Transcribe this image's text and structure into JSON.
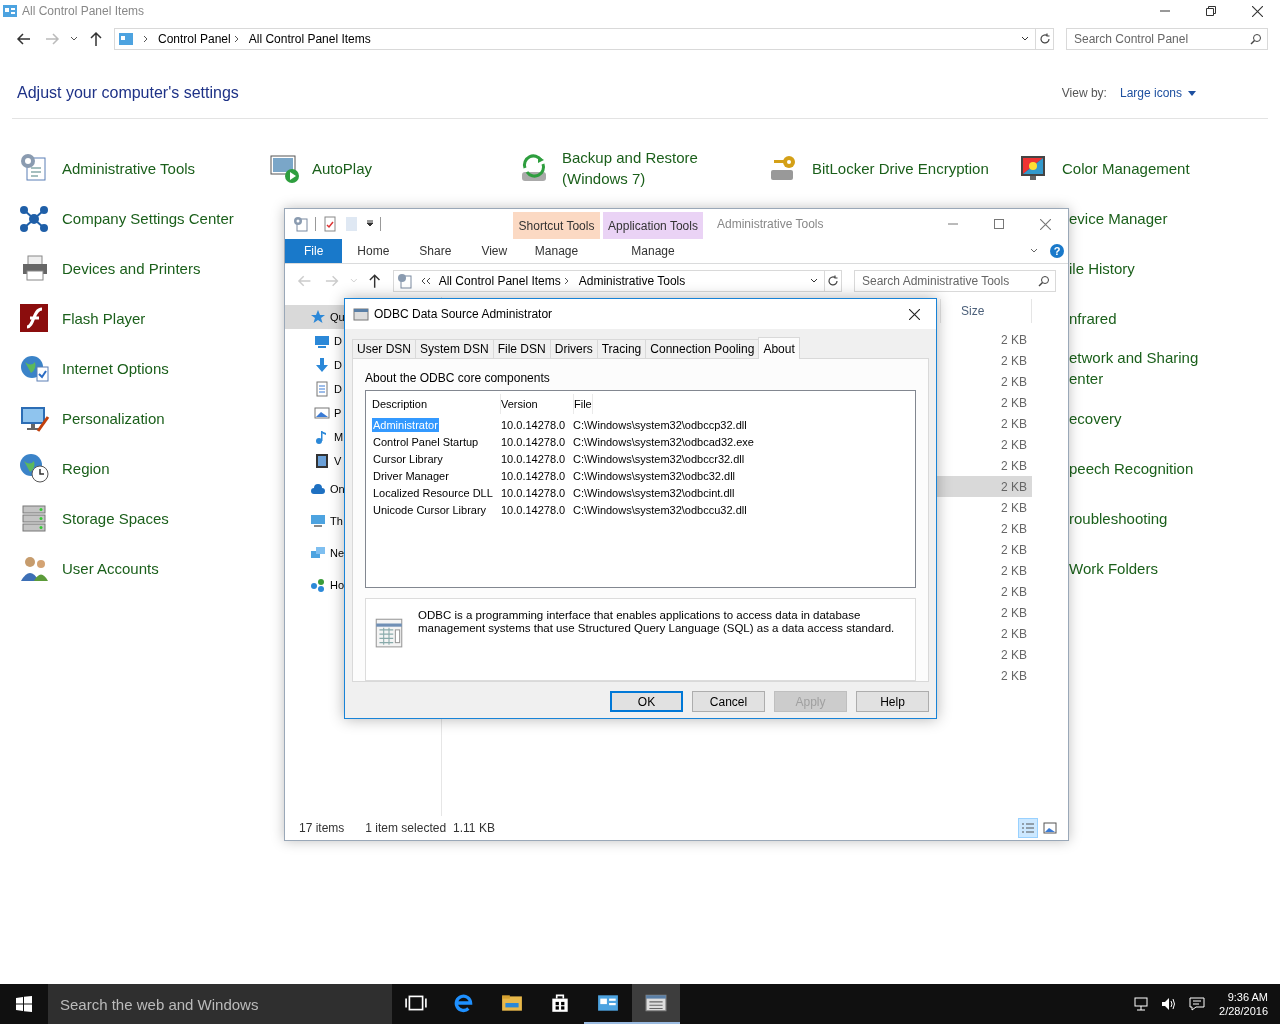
{
  "window": {
    "title": "All Control Panel Items"
  },
  "address_bar": {
    "crumbs": [
      "Control Panel",
      "All Control Panel Items"
    ]
  },
  "search": {
    "placeholder": "Search Control Panel"
  },
  "heading": "Adjust your computer's settings",
  "view_by": {
    "label": "View by:",
    "value": "Large icons"
  },
  "control_panel": {
    "columns": [
      {
        "items": [
          {
            "label": "Administrative Tools"
          },
          {
            "label": "Company Settings Center"
          },
          {
            "label": "Devices and Printers"
          },
          {
            "label": "Flash Player"
          },
          {
            "label": "Internet Options"
          },
          {
            "label": "Personalization"
          },
          {
            "label": "Region"
          },
          {
            "label": "Storage Spaces"
          },
          {
            "label": "User Accounts"
          }
        ]
      },
      {
        "items": [
          {
            "label": "AutoPlay"
          }
        ]
      },
      {
        "items": [
          {
            "label": "Backup and Restore (Windows 7)"
          }
        ]
      },
      {
        "items": [
          {
            "label": "BitLocker Drive Encryption"
          }
        ]
      },
      {
        "items": [
          {
            "label": "Color Management"
          },
          {
            "label": "evice Manager"
          },
          {
            "label": "ile History"
          },
          {
            "label": "nfrared"
          },
          {
            "label": "etwork and Sharing enter"
          },
          {
            "label": "ecovery"
          },
          {
            "label": "peech Recognition"
          },
          {
            "label": "roubleshooting"
          },
          {
            "label": "Work Folders"
          }
        ]
      }
    ]
  },
  "explorer": {
    "title": "Administrative Tools",
    "context_groups": [
      {
        "label": "Shortcut Tools",
        "color": "#fbd9c3",
        "tab": {
          "label": "Manage",
          "selected": false
        }
      },
      {
        "label": "Application Tools",
        "color": "#ead3f5",
        "tab": {
          "label": "Manage",
          "selected": false
        }
      }
    ],
    "ribbon_tabs": [
      {
        "label": "File",
        "selected": true
      },
      {
        "label": "Home",
        "selected": false
      },
      {
        "label": "Share",
        "selected": false
      },
      {
        "label": "View",
        "selected": false
      }
    ],
    "help": "?",
    "address": [
      "All Control Panel Items",
      "Administrative Tools"
    ],
    "search": {
      "placeholder": "Search Administrative Tools"
    },
    "nav": [
      {
        "label": "Qu",
        "selected": true,
        "children": [
          {
            "label": "D",
            "selected": false
          },
          {
            "label": "D",
            "selected": false
          },
          {
            "label": "D",
            "selected": false
          },
          {
            "label": "P",
            "selected": false
          },
          {
            "label": "M",
            "selected": false
          },
          {
            "label": "V",
            "selected": false
          }
        ]
      },
      {
        "label": "On",
        "selected": false
      },
      {
        "label": "Th",
        "selected": false
      },
      {
        "label": "Ne",
        "selected": false
      },
      {
        "label": "Ho",
        "selected": false
      }
    ],
    "size_header": "Size",
    "files": [
      {
        "size": "2 KB",
        "selected": false
      },
      {
        "size": "2 KB",
        "selected": false
      },
      {
        "size": "2 KB",
        "selected": false
      },
      {
        "size": "2 KB",
        "selected": false
      },
      {
        "size": "2 KB",
        "selected": false
      },
      {
        "size": "2 KB",
        "selected": false
      },
      {
        "size": "2 KB",
        "selected": false
      },
      {
        "size": "2 KB",
        "selected": true
      },
      {
        "size": "2 KB",
        "selected": false
      },
      {
        "size": "2 KB",
        "selected": false
      },
      {
        "size": "2 KB",
        "selected": false
      },
      {
        "size": "2 KB",
        "selected": false
      },
      {
        "size": "2 KB",
        "selected": false
      },
      {
        "size": "2 KB",
        "selected": false
      },
      {
        "size": "2 KB",
        "selected": false
      },
      {
        "size": "2 KB",
        "selected": false
      },
      {
        "size": "2 KB",
        "selected": false
      }
    ],
    "status": {
      "count": "17 items",
      "selection": "1 item selected",
      "size": "1.11 KB"
    },
    "views": [
      {
        "selected": true
      },
      {
        "selected": false
      }
    ]
  },
  "dialog": {
    "title": "ODBC Data Source Administrator",
    "tabs": [
      {
        "label": "User DSN",
        "selected": false
      },
      {
        "label": "System DSN",
        "selected": false
      },
      {
        "label": "File DSN",
        "selected": false
      },
      {
        "label": "Drivers",
        "selected": false
      },
      {
        "label": "Tracing",
        "selected": false
      },
      {
        "label": "Connection Pooling",
        "selected": false
      },
      {
        "label": "About",
        "selected": true
      }
    ],
    "caption": "About the ODBC core components",
    "columns": [
      "Description",
      "Version",
      "File"
    ],
    "rows": [
      {
        "cells": [
          "Administrator",
          "10.0.14278.0",
          "C:\\Windows\\system32\\odbccp32.dll"
        ],
        "selected": true
      },
      {
        "cells": [
          "Control Panel Startup",
          "10.0.14278.0",
          "C:\\Windows\\system32\\odbcad32.exe"
        ],
        "selected": false
      },
      {
        "cells": [
          "Cursor Library",
          "10.0.14278.0",
          "C:\\Windows\\system32\\odbccr32.dll"
        ],
        "selected": false
      },
      {
        "cells": [
          "Driver Manager",
          "10.0.14278.0",
          "C:\\Windows\\system32\\odbc32.dll"
        ],
        "selected": false
      },
      {
        "cells": [
          "Localized Resource DLL",
          "10.0.14278.0",
          "C:\\Windows\\system32\\odbcint.dll"
        ],
        "selected": false
      },
      {
        "cells": [
          "Unicode Cursor Library",
          "10.0.14278.0",
          "C:\\Windows\\system32\\odbccu32.dll"
        ],
        "selected": false
      }
    ],
    "info": "ODBC is a programming interface that enables applications to access data in database management systems that use Structured Query Language (SQL) as a data access standard.",
    "buttons": [
      {
        "label": "OK",
        "default": true,
        "disabled": false
      },
      {
        "label": "Cancel",
        "default": false,
        "disabled": false
      },
      {
        "label": "Apply",
        "default": false,
        "disabled": true
      },
      {
        "label": "Help",
        "default": false,
        "disabled": false
      }
    ]
  },
  "taskbar": {
    "search_placeholder": "Search the web and Windows",
    "apps": [
      {
        "open": false,
        "selected": false
      },
      {
        "open": false,
        "selected": false
      },
      {
        "open": false,
        "selected": false
      },
      {
        "open": false,
        "selected": false
      },
      {
        "open": true,
        "selected": false
      },
      {
        "open": true,
        "selected": true
      }
    ],
    "time": "9:36 AM",
    "date": "2/28/2016"
  }
}
